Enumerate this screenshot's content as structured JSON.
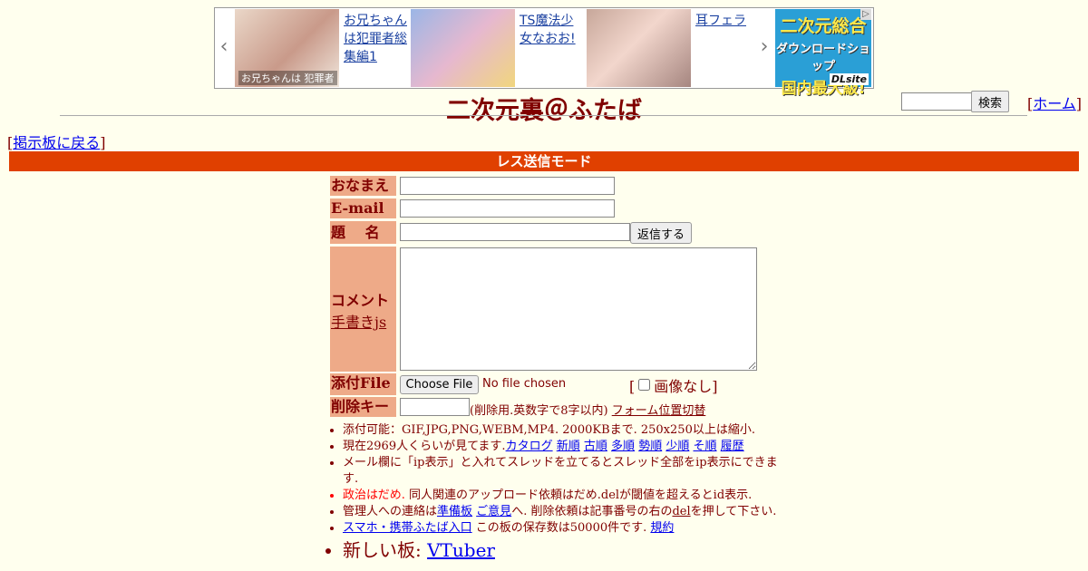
{
  "ad": {
    "items": [
      {
        "caption": "お兄ちゃんは犯罪者総集編1",
        "thumb_text": "お兄ちゃんは 犯罪者"
      },
      {
        "caption": "TS魔法少女なおお!"
      },
      {
        "caption": "耳フェラ"
      }
    ],
    "dlsite": {
      "line1": "二次元総合",
      "line2": "ダウンロードショップ",
      "line3": "国内最大級!",
      "brand": "DLsite"
    }
  },
  "header": {
    "title": "二次元裏＠ふたば",
    "search_button": "検索",
    "home_link": "ホーム",
    "back_link": "掲示板に戻る"
  },
  "mode_bar": "レス送信モード",
  "form": {
    "name_label": "おなまえ",
    "email_label": "E-mail",
    "subject_label": "題　 名",
    "submit_button": "返信する",
    "comment_label": "コメント",
    "handwriting_link": "手書きjs",
    "file_label": "添付File",
    "choose_file_button": "Choose File",
    "no_file_text": "No file chosen",
    "no_image_label": "画像なし",
    "delkey_label": "削除キー",
    "delkey_note": "(削除用.英数字で8字以内)",
    "form_position_link": "フォーム位置切替"
  },
  "notes": {
    "n1": "添付可能：GIF,JPG,PNG,WEBM,MP4. 2000KBまで. 250x250以上は縮小.",
    "n2_prefix": "現在2969人くらいが見てます.",
    "n2_links": [
      "カタログ",
      "新順",
      "古順",
      "多順",
      "勢順",
      "少順",
      "そ順",
      "履歴"
    ],
    "n3": "メール欄に「ip表示」と入れてスレッドを立てるとスレッド全部をip表示にできます.",
    "n4_red": "政治はだめ.",
    "n4_rest": "同人関連のアップロード依頼はだめ.delが閾値を超えるとid表示.",
    "n5_a": "管理人への連絡は",
    "n5_link1": "準備板",
    "n5_link2": "ご意見",
    "n5_b": "へ. 削除依頼は記事番号の右の",
    "n5_link3": "del",
    "n5_c": "を押して下さい.",
    "n6_link": "スマホ・携帯ふたば入口",
    "n6_text": "この板の保存数は50000件です.",
    "n6_link2": "規約",
    "n7_prefix": "新しい板:",
    "n7_link": "VTuber"
  }
}
